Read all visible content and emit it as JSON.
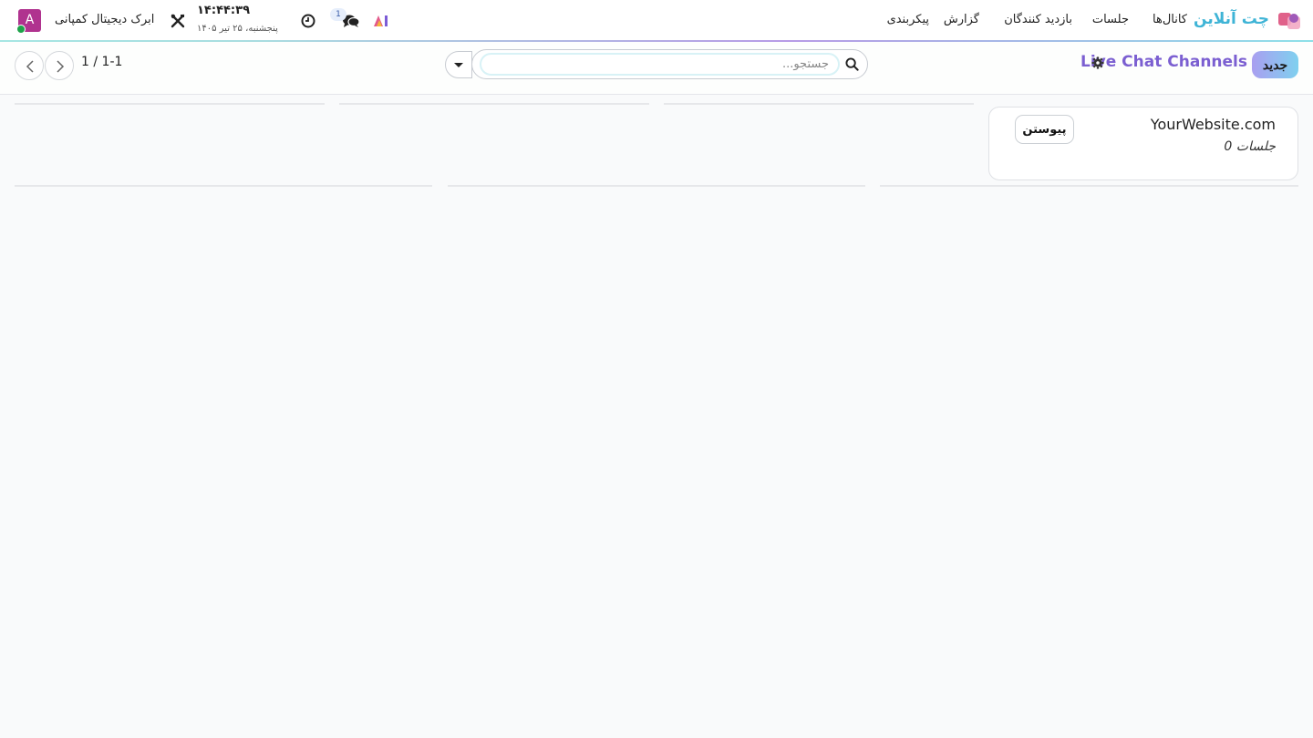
{
  "navbar": {
    "app_name": "چت آنلاین",
    "menu": [
      "کانال‌ها",
      "جلسات",
      "بازدید کنندگان",
      "گزارش",
      "پیکربندی"
    ],
    "chat_badge": "1",
    "clock_time": "۱۴:۴۴:۳۹",
    "clock_date": "پنجشنبه، ۲۵ تیر ۱۴۰۵",
    "company": "ابرک دیجیتال کمپانی",
    "avatar_letter": "A",
    "icons": [
      "app-logo-icon",
      "ai-icon",
      "chat-bubbles-icon",
      "activity-clock-icon",
      "tools-icon"
    ]
  },
  "control_panel": {
    "new_button": "جدید",
    "breadcrumb": "Live Chat Channels",
    "search_placeholder": "جستجو...",
    "pager_value": "1-1",
    "pager_total": "1 /"
  },
  "channels": [
    {
      "name": "YourWebsite.com",
      "sessions": "0 جلسات",
      "join_label": "پیوستن"
    }
  ],
  "colors": {
    "brand": "#3fb4d6",
    "accent": "#7b5fd1",
    "avatar_bg": "#b0338f",
    "presence": "#1ea34a"
  }
}
